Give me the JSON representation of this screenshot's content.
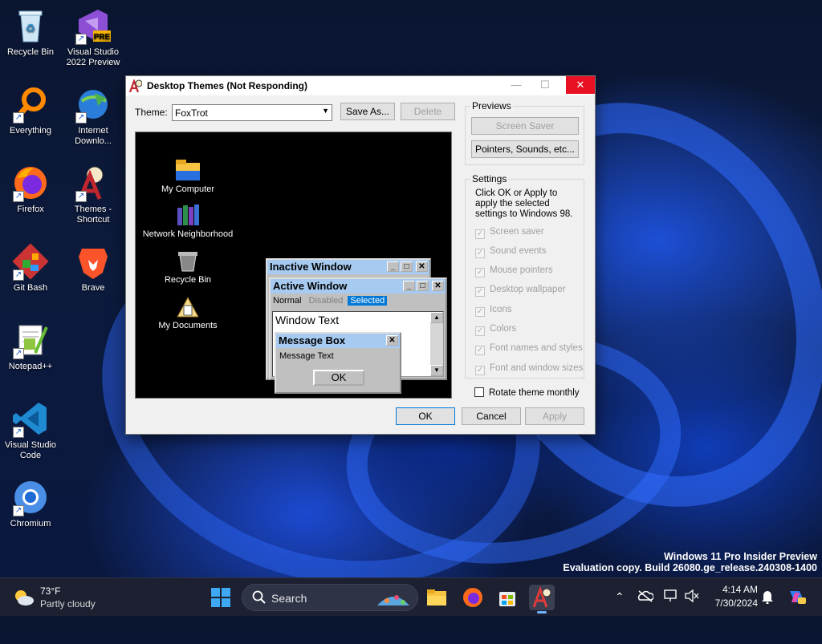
{
  "desktop": {
    "icons": [
      {
        "label": "Recycle Bin",
        "icon": "recycle-bin-icon"
      },
      {
        "label": "Visual Studio 2022 Preview",
        "icon": "visual-studio-icon",
        "badge": "PRE"
      },
      {
        "label": "Everything",
        "icon": "everything-search-icon"
      },
      {
        "label": "Internet Downlo...",
        "icon": "internet-download-manager-icon"
      },
      {
        "label": "Firefox",
        "icon": "firefox-icon"
      },
      {
        "label": "Themes - Shortcut",
        "icon": "themes-icon"
      },
      {
        "label": "Git Bash",
        "icon": "git-bash-icon"
      },
      {
        "label": "Brave",
        "icon": "brave-icon"
      },
      {
        "label": "Notepad++",
        "icon": "notepadpp-icon"
      },
      {
        "label": "Visual Studio Code",
        "icon": "vscode-icon"
      },
      {
        "label": "Chromium",
        "icon": "chromium-icon"
      }
    ],
    "watermark": {
      "line1": "Windows 11 Pro Insider Preview",
      "line2": "Evaluation copy. Build 26080.ge_release.240308-1400"
    }
  },
  "dialog": {
    "title": "Desktop Themes (Not Responding)",
    "theme_label": "Theme:",
    "theme_value": "FoxTrot",
    "save_as": "Save As...",
    "delete": "Delete",
    "previews": {
      "legend": "Previews",
      "screen_saver": "Screen Saver",
      "pointers": "Pointers, Sounds, etc..."
    },
    "settings": {
      "legend": "Settings",
      "note": "Click OK or Apply to apply the selected settings to Windows 98.",
      "options": [
        "Screen saver",
        "Sound events",
        "Mouse pointers",
        "Desktop wallpaper",
        "Icons",
        "Colors",
        "Font names and styles",
        "Font and window sizes"
      ]
    },
    "rotate": "Rotate theme monthly",
    "ok": "OK",
    "cancel": "Cancel",
    "apply": "Apply",
    "preview": {
      "icons": [
        "My Computer",
        "Network Neighborhood",
        "Recycle Bin",
        "My Documents"
      ],
      "inactive_title": "Inactive Window",
      "active_title": "Active Window",
      "menu": [
        "Normal",
        "Disabled",
        "Selected"
      ],
      "window_text": "Window Text",
      "msgbox_title": "Message Box",
      "msgbox_text": "Message Text",
      "msgbox_ok": "OK"
    }
  },
  "taskbar": {
    "weather_temp": "73°F",
    "weather_desc": "Partly cloudy",
    "search": "Search",
    "time": "4:14 AM",
    "date": "7/30/2024"
  },
  "colors": {
    "accent": "#0078d7",
    "close_red": "#e81123",
    "caption_blue": "#a6caf0"
  }
}
